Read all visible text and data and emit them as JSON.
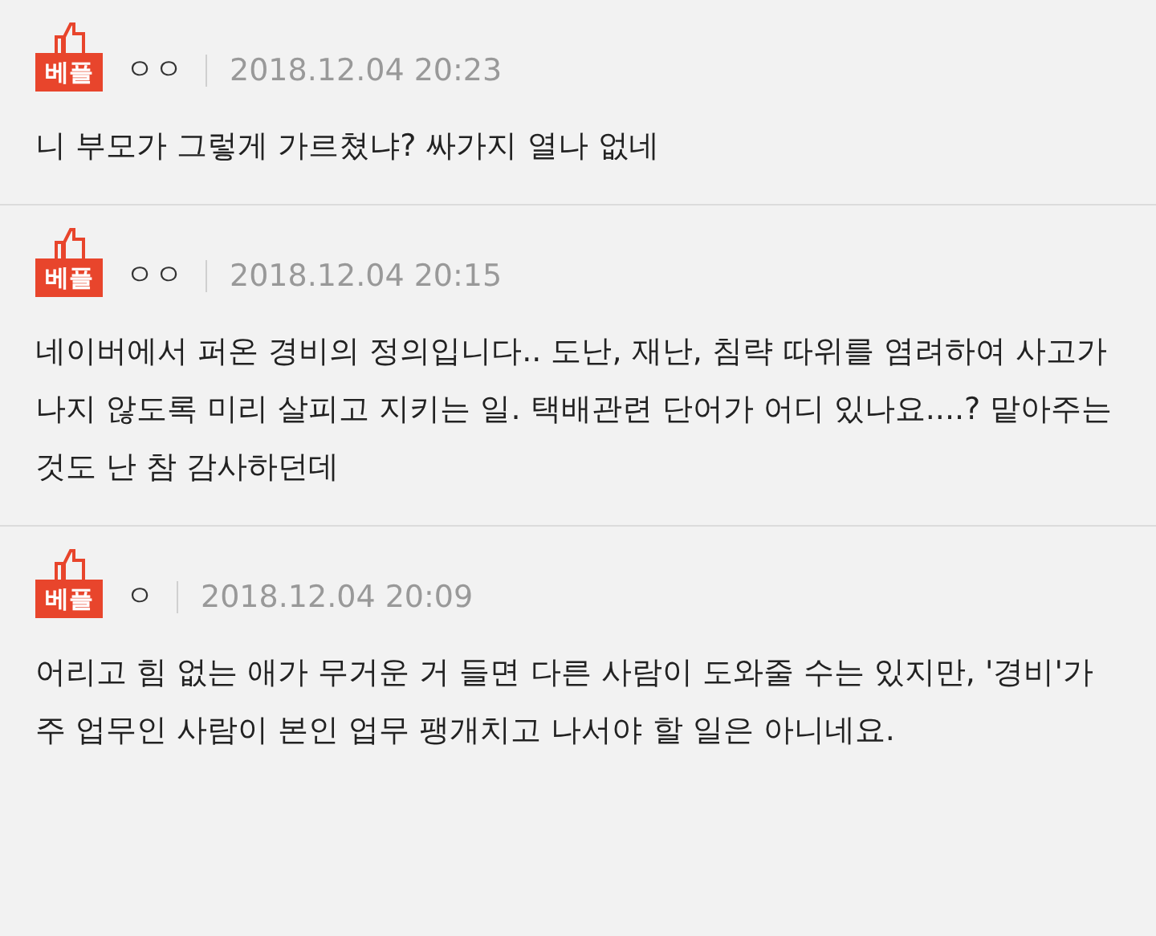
{
  "comments": [
    {
      "badge": "베플",
      "author": "ㅇㅇ",
      "date": "2018.12.04 20:23",
      "text": "니 부모가 그렇게 가르쳤냐? 싸가지 열나 없네"
    },
    {
      "badge": "베플",
      "author": "ㅇㅇ",
      "date": "2018.12.04 20:15",
      "text": "네이버에서 퍼온 경비의 정의입니다.. 도난, 재난, 침략 따위를 염려하여 사고가 나지 않도록 미리 살피고 지키는 일. 택배관련 단어가 어디 있나요....? 맡아주는것도 난 참 감사하던데"
    },
    {
      "badge": "베플",
      "author": "ㅇ",
      "date": "2018.12.04 20:09",
      "text": "어리고 힘 없는 애가 무거운 거 들면 다른 사람이 도와줄 수는 있지만, '경비'가 주 업무인 사람이 본인 업무 팽개치고 나서야 할 일은 아니네요."
    }
  ]
}
